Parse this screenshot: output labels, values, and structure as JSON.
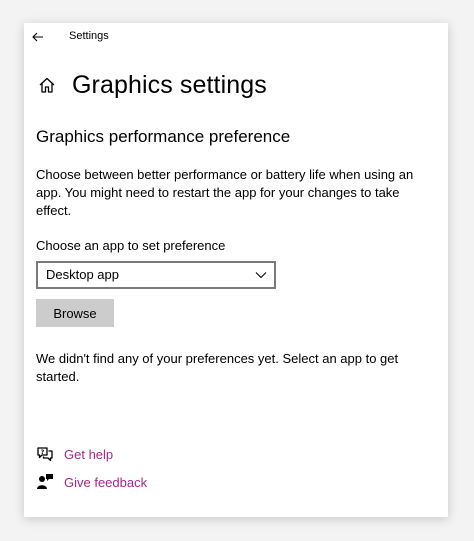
{
  "window": {
    "title": "Settings"
  },
  "page": {
    "title": "Graphics settings",
    "section_title": "Graphics performance preference",
    "description": "Choose between better performance or battery life when using an app. You might need to restart the app for your changes to take effect.",
    "choose_label": "Choose an app to set preference",
    "app_type": {
      "selected": "Desktop app"
    },
    "browse_label": "Browse",
    "empty_message": "We didn't find any of your preferences yet. Select an app to get started."
  },
  "links": {
    "help": "Get help",
    "feedback": "Give feedback"
  },
  "colors": {
    "link": "#a4288c",
    "button_bg": "#cccccc",
    "select_border": "#7a7a7a"
  },
  "icons": {
    "back": "back-arrow-icon",
    "home": "home-icon",
    "dropdown": "chevron-down-icon",
    "help": "help-chat-icon",
    "feedback": "feedback-person-icon"
  }
}
